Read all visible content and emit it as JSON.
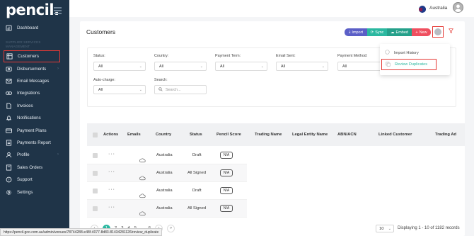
{
  "app": {
    "logo": "pencil."
  },
  "sidebar": {
    "section_label": "SUPPLIER SERVICES\nMANAGEMENT",
    "items": [
      {
        "label": "Dashboard",
        "icon": "dashboard-icon"
      },
      {
        "label": "Customers",
        "icon": "customers-icon"
      },
      {
        "label": "Disbursements",
        "icon": "disbursements-icon"
      },
      {
        "label": "Email Messages",
        "icon": "mail-icon"
      },
      {
        "label": "Integrations",
        "icon": "link-icon"
      },
      {
        "label": "Invoices",
        "icon": "invoice-icon"
      },
      {
        "label": "Notifications",
        "icon": "bell-icon"
      },
      {
        "label": "Payment Plans",
        "icon": "card-icon"
      },
      {
        "label": "Payments Report",
        "icon": "report-icon"
      },
      {
        "label": "Profile",
        "icon": "user-icon"
      },
      {
        "label": "Sales Orders",
        "icon": "cart-icon"
      },
      {
        "label": "Support",
        "icon": "support-icon"
      },
      {
        "label": "Settings",
        "icon": "gear-icon"
      }
    ]
  },
  "topbar": {
    "country": "Australia"
  },
  "page": {
    "title": "Customers",
    "buttons": {
      "import": "Import",
      "sync": "Sync",
      "embed": "Embed",
      "new": "New"
    }
  },
  "dropdown": {
    "import_history": "Import History",
    "review_duplicates": "Review Duplicates"
  },
  "filters": {
    "status": {
      "label": "Status:",
      "value": "All"
    },
    "country": {
      "label": "Country:",
      "value": "All"
    },
    "payment_term": {
      "label": "Payment Term:",
      "value": "All"
    },
    "email_sent": {
      "label": "Email Sent:",
      "value": "All"
    },
    "payment_method": {
      "label": "Payment Method:",
      "value": "All"
    },
    "auto_charge": {
      "label": "Auto-charge:",
      "value": "All"
    },
    "search": {
      "label": "Search:",
      "placeholder": "Search..."
    }
  },
  "table": {
    "columns": [
      "Actions",
      "Emails",
      "Country",
      "Status",
      "Pencil Score",
      "Trading Name",
      "Legal Entity Name",
      "ABN/ACN",
      "Linked Customer",
      "Trading Ad"
    ],
    "rows": [
      {
        "actions": "···",
        "country": "Australia",
        "status": "Draft",
        "score": "N/A"
      },
      {
        "actions": "···",
        "country": "Australia",
        "status": "All Signed",
        "score": "N/A"
      },
      {
        "actions": "···",
        "country": "Australia",
        "status": "Draft",
        "score": "N/A"
      },
      {
        "actions": "···",
        "country": "Australia",
        "status": "All Signed",
        "score": "N/A"
      }
    ]
  },
  "pagination": {
    "pages": [
      "1",
      "2",
      "3",
      "4",
      "5",
      "6"
    ],
    "ellipsis": "...",
    "per_page": "10",
    "records": "Displaying 1 - 10 of 1182 records"
  },
  "status_url": "https://pencil.goo.com.au/admin/venues/78744288-e48f-4077-8d83-81434281126/review_duplicate",
  "colors": {
    "sidebar": "#1f3448",
    "accent": "#2bb8a0",
    "highlight": "#e53935",
    "import": "#5b5fc7",
    "new": "#ef4f5f"
  }
}
